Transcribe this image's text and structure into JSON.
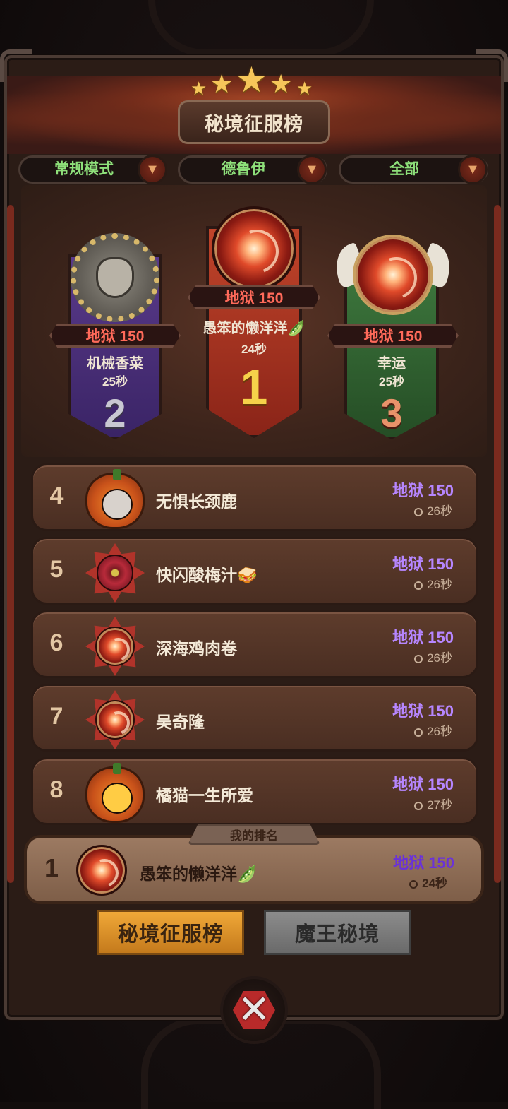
{
  "header": {
    "title": "秘境征服榜",
    "star_count": 5
  },
  "filters": [
    {
      "label": "常规模式"
    },
    {
      "label": "德鲁伊"
    },
    {
      "label": "全部"
    }
  ],
  "podium": {
    "first": {
      "rank": "1",
      "difficulty": "地狱 150",
      "name": "愚笨的懒洋洋🫛",
      "time": "24秒"
    },
    "second": {
      "rank": "2",
      "difficulty": "地狱 150",
      "name": "机械香菜",
      "time": "25秒"
    },
    "third": {
      "rank": "3",
      "difficulty": "地狱 150",
      "name": "幸运",
      "time": "25秒"
    }
  },
  "list": [
    {
      "rank": "4",
      "name": "无惧长颈鹿",
      "difficulty": "地狱 150",
      "time": "26秒",
      "avatar": "pumpkin-sheep"
    },
    {
      "rank": "5",
      "name": "快闪酸梅汁🥪",
      "difficulty": "地狱 150",
      "time": "26秒",
      "avatar": "red-eye-emblem"
    },
    {
      "rank": "6",
      "name": "深海鸡肉卷",
      "difficulty": "地狱 150",
      "time": "26秒",
      "avatar": "swirl-emblem"
    },
    {
      "rank": "7",
      "name": "吴奇隆",
      "difficulty": "地狱 150",
      "time": "26秒",
      "avatar": "swirl-emblem"
    },
    {
      "rank": "8",
      "name": "橘猫一生所爱",
      "difficulty": "地狱 150",
      "time": "27秒",
      "avatar": "pumpkin-lantern"
    }
  ],
  "my_rank": {
    "tab_label": "我的排名",
    "rank": "1",
    "name": "愚笨的懒洋洋🫛",
    "difficulty": "地狱 150",
    "time": "24秒"
  },
  "tabs": [
    {
      "label": "秘境征服榜",
      "active": true
    },
    {
      "label": "魔王秘境",
      "active": false
    }
  ],
  "colors": {
    "difficulty_purple": "#b686ff",
    "hell_red": "#ff6a5a",
    "filter_green": "#8ee07a",
    "active_tab": "#f0a838"
  },
  "icons": {
    "close": "close-icon",
    "dropdown": "chevron-down-icon",
    "time": "clock-icon"
  }
}
